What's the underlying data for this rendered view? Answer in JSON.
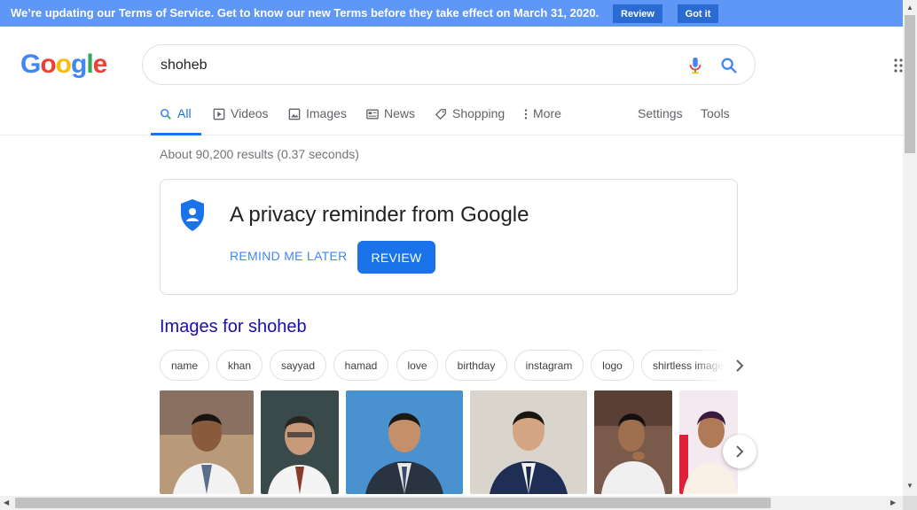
{
  "banner": {
    "text": "We’re updating our Terms of Service. Get to know our new Terms before they take effect on March 31, 2020.",
    "review_label": "Review",
    "gotit_label": "Got it"
  },
  "logo": {
    "letters": [
      "G",
      "o",
      "o",
      "g",
      "l",
      "e"
    ]
  },
  "search": {
    "query": "shoheb"
  },
  "tabs": [
    {
      "label": "All",
      "icon": "search-icon"
    },
    {
      "label": "Videos",
      "icon": "play-icon"
    },
    {
      "label": "Images",
      "icon": "image-icon"
    },
    {
      "label": "News",
      "icon": "news-icon"
    },
    {
      "label": "Shopping",
      "icon": "tag-icon"
    },
    {
      "label": "More",
      "icon": "more-vert-icon"
    }
  ],
  "tools": {
    "settings_label": "Settings",
    "tools_label": "Tools"
  },
  "result_stats": "About 90,200 results (0.37 seconds)",
  "privacy_card": {
    "title": "A privacy reminder from Google",
    "remind_label": "REMIND ME LATER",
    "review_label": "REVIEW"
  },
  "images_section": {
    "heading": "Images for shoheb",
    "chips": [
      "name",
      "khan",
      "sayyad",
      "hamad",
      "love",
      "birthday",
      "instagram",
      "logo",
      "shirtless images"
    ]
  },
  "colors": {
    "banner_bg": "#5e97f6",
    "accent_blue": "#1a73e8",
    "link_purple": "#1a0dab"
  }
}
